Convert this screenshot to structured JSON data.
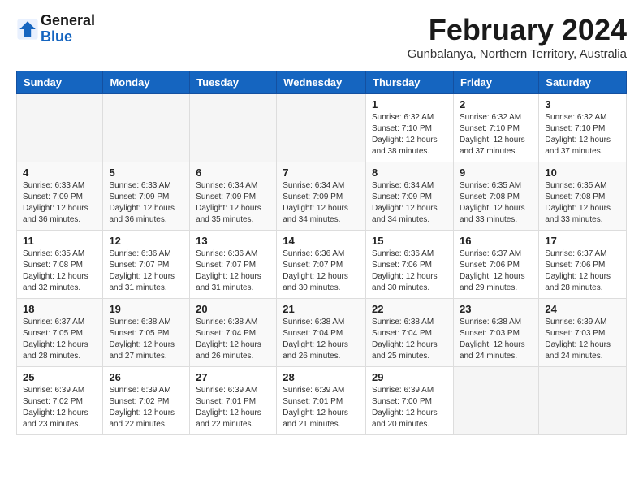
{
  "logo": {
    "line1": "General",
    "line2": "Blue",
    "icon_color": "#1565c0"
  },
  "title": "February 2024",
  "subtitle": "Gunbalanya, Northern Territory, Australia",
  "days_of_week": [
    "Sunday",
    "Monday",
    "Tuesday",
    "Wednesday",
    "Thursday",
    "Friday",
    "Saturday"
  ],
  "weeks": [
    [
      {
        "day": "",
        "info": ""
      },
      {
        "day": "",
        "info": ""
      },
      {
        "day": "",
        "info": ""
      },
      {
        "day": "",
        "info": ""
      },
      {
        "day": "1",
        "info": "Sunrise: 6:32 AM\nSunset: 7:10 PM\nDaylight: 12 hours\nand 38 minutes."
      },
      {
        "day": "2",
        "info": "Sunrise: 6:32 AM\nSunset: 7:10 PM\nDaylight: 12 hours\nand 37 minutes."
      },
      {
        "day": "3",
        "info": "Sunrise: 6:32 AM\nSunset: 7:10 PM\nDaylight: 12 hours\nand 37 minutes."
      }
    ],
    [
      {
        "day": "4",
        "info": "Sunrise: 6:33 AM\nSunset: 7:09 PM\nDaylight: 12 hours\nand 36 minutes."
      },
      {
        "day": "5",
        "info": "Sunrise: 6:33 AM\nSunset: 7:09 PM\nDaylight: 12 hours\nand 36 minutes."
      },
      {
        "day": "6",
        "info": "Sunrise: 6:34 AM\nSunset: 7:09 PM\nDaylight: 12 hours\nand 35 minutes."
      },
      {
        "day": "7",
        "info": "Sunrise: 6:34 AM\nSunset: 7:09 PM\nDaylight: 12 hours\nand 34 minutes."
      },
      {
        "day": "8",
        "info": "Sunrise: 6:34 AM\nSunset: 7:09 PM\nDaylight: 12 hours\nand 34 minutes."
      },
      {
        "day": "9",
        "info": "Sunrise: 6:35 AM\nSunset: 7:08 PM\nDaylight: 12 hours\nand 33 minutes."
      },
      {
        "day": "10",
        "info": "Sunrise: 6:35 AM\nSunset: 7:08 PM\nDaylight: 12 hours\nand 33 minutes."
      }
    ],
    [
      {
        "day": "11",
        "info": "Sunrise: 6:35 AM\nSunset: 7:08 PM\nDaylight: 12 hours\nand 32 minutes."
      },
      {
        "day": "12",
        "info": "Sunrise: 6:36 AM\nSunset: 7:07 PM\nDaylight: 12 hours\nand 31 minutes."
      },
      {
        "day": "13",
        "info": "Sunrise: 6:36 AM\nSunset: 7:07 PM\nDaylight: 12 hours\nand 31 minutes."
      },
      {
        "day": "14",
        "info": "Sunrise: 6:36 AM\nSunset: 7:07 PM\nDaylight: 12 hours\nand 30 minutes."
      },
      {
        "day": "15",
        "info": "Sunrise: 6:36 AM\nSunset: 7:06 PM\nDaylight: 12 hours\nand 30 minutes."
      },
      {
        "day": "16",
        "info": "Sunrise: 6:37 AM\nSunset: 7:06 PM\nDaylight: 12 hours\nand 29 minutes."
      },
      {
        "day": "17",
        "info": "Sunrise: 6:37 AM\nSunset: 7:06 PM\nDaylight: 12 hours\nand 28 minutes."
      }
    ],
    [
      {
        "day": "18",
        "info": "Sunrise: 6:37 AM\nSunset: 7:05 PM\nDaylight: 12 hours\nand 28 minutes."
      },
      {
        "day": "19",
        "info": "Sunrise: 6:38 AM\nSunset: 7:05 PM\nDaylight: 12 hours\nand 27 minutes."
      },
      {
        "day": "20",
        "info": "Sunrise: 6:38 AM\nSunset: 7:04 PM\nDaylight: 12 hours\nand 26 minutes."
      },
      {
        "day": "21",
        "info": "Sunrise: 6:38 AM\nSunset: 7:04 PM\nDaylight: 12 hours\nand 26 minutes."
      },
      {
        "day": "22",
        "info": "Sunrise: 6:38 AM\nSunset: 7:04 PM\nDaylight: 12 hours\nand 25 minutes."
      },
      {
        "day": "23",
        "info": "Sunrise: 6:38 AM\nSunset: 7:03 PM\nDaylight: 12 hours\nand 24 minutes."
      },
      {
        "day": "24",
        "info": "Sunrise: 6:39 AM\nSunset: 7:03 PM\nDaylight: 12 hours\nand 24 minutes."
      }
    ],
    [
      {
        "day": "25",
        "info": "Sunrise: 6:39 AM\nSunset: 7:02 PM\nDaylight: 12 hours\nand 23 minutes."
      },
      {
        "day": "26",
        "info": "Sunrise: 6:39 AM\nSunset: 7:02 PM\nDaylight: 12 hours\nand 22 minutes."
      },
      {
        "day": "27",
        "info": "Sunrise: 6:39 AM\nSunset: 7:01 PM\nDaylight: 12 hours\nand 22 minutes."
      },
      {
        "day": "28",
        "info": "Sunrise: 6:39 AM\nSunset: 7:01 PM\nDaylight: 12 hours\nand 21 minutes."
      },
      {
        "day": "29",
        "info": "Sunrise: 6:39 AM\nSunset: 7:00 PM\nDaylight: 12 hours\nand 20 minutes."
      },
      {
        "day": "",
        "info": ""
      },
      {
        "day": "",
        "info": ""
      }
    ]
  ]
}
